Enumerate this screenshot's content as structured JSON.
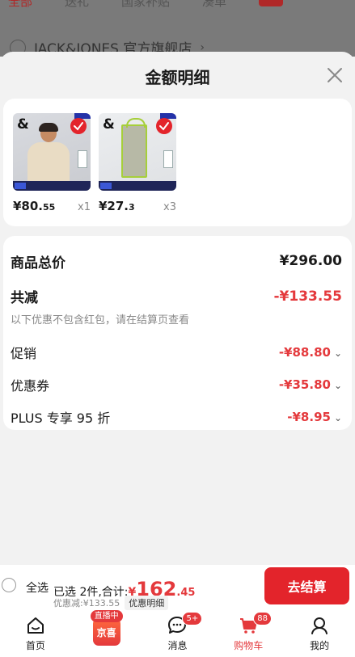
{
  "background": {
    "tabs": [
      "全部",
      "送礼",
      "国家补贴",
      "凑单"
    ],
    "shop_name": "JACK&JONES 官方旗舰店"
  },
  "sheet": {
    "title": "金额明细",
    "products": [
      {
        "price_int": "¥80.",
        "price_dec": "55",
        "qty": "x1",
        "brand_mark": "&"
      },
      {
        "price_int": "¥27.",
        "price_dec": "3",
        "qty": "x3",
        "brand_mark": "&"
      }
    ],
    "summary": {
      "total_label": "商品总价",
      "total_value": "¥296.00",
      "discount_label": "共减",
      "discount_value": "-¥133.55",
      "discount_note": "以下优惠不包含红包，请在结算页查看",
      "items": [
        {
          "label": "促销",
          "value": "-¥88.80"
        },
        {
          "label": "优惠券",
          "value": "-¥35.80"
        },
        {
          "label": "PLUS 专享 95 折",
          "value": "-¥8.95"
        }
      ]
    }
  },
  "checkout": {
    "select_all": "全选",
    "selected_text": "已选 2件,合计:",
    "currency": "¥",
    "amount_int": "162",
    "amount_dec": ".45",
    "discount_text": "优惠减:¥133.55",
    "detail_label": "优惠明细",
    "pay_label": "去结算"
  },
  "tabbar": {
    "items": [
      {
        "label": "首页"
      },
      {
        "label": "京喜",
        "badge": "直播中"
      },
      {
        "label": "消息",
        "badge": "5+"
      },
      {
        "label": "购物车",
        "badge": "88"
      },
      {
        "label": "我的"
      }
    ]
  },
  "colors": {
    "accent": "#e4393c",
    "background": "#f2f2f2"
  }
}
